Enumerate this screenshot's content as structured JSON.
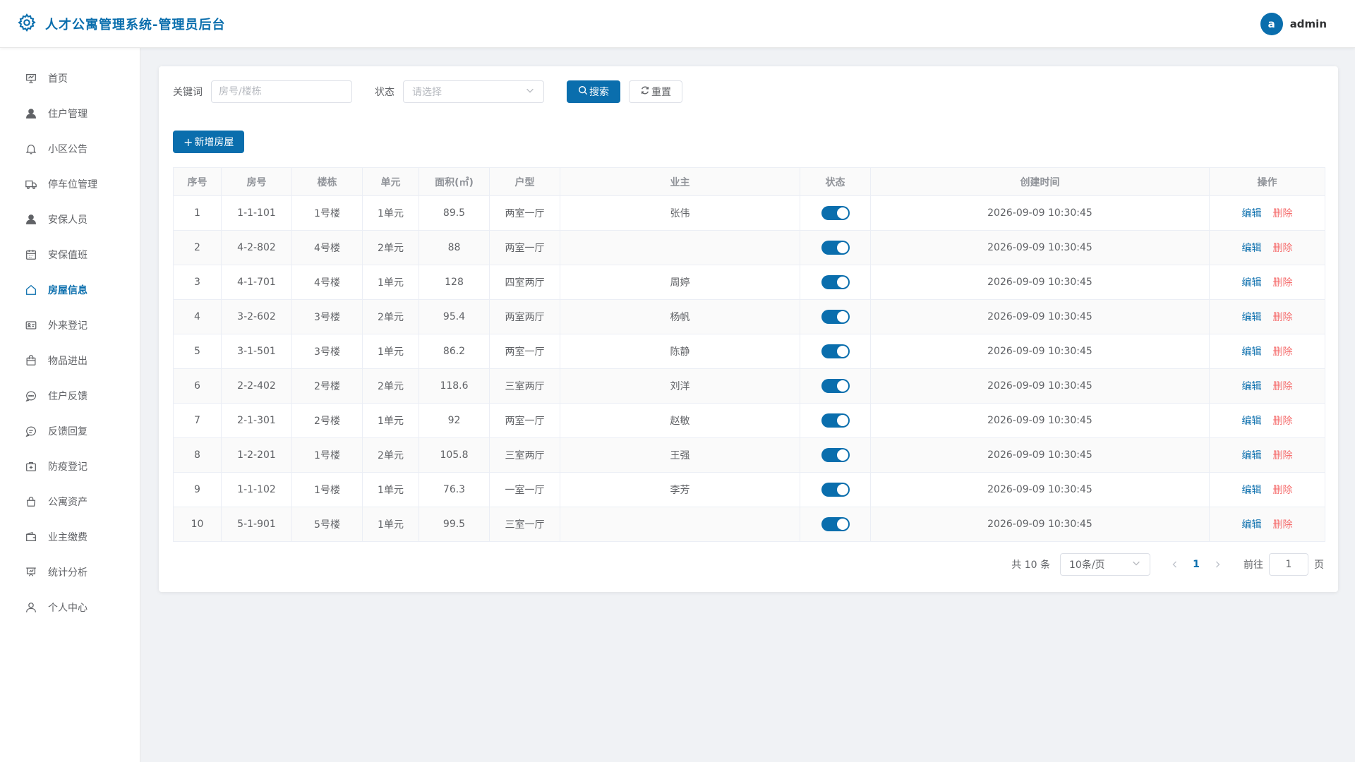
{
  "header": {
    "title": "人才公寓管理系统-管理员后台",
    "avatar_letter": "a",
    "username": "admin"
  },
  "sidebar": {
    "items": [
      {
        "label": "首页",
        "icon": "presentation-icon"
      },
      {
        "label": "住户管理",
        "icon": "user-solid-icon"
      },
      {
        "label": "小区公告",
        "icon": "bell-icon"
      },
      {
        "label": "停车位管理",
        "icon": "truck-icon"
      },
      {
        "label": "安保人员",
        "icon": "user-solid-icon"
      },
      {
        "label": "安保值班",
        "icon": "calendar-icon"
      },
      {
        "label": "房屋信息",
        "icon": "house-icon",
        "active": true
      },
      {
        "label": "外来登记",
        "icon": "id-card-icon"
      },
      {
        "label": "物品进出",
        "icon": "shopping-bag-icon"
      },
      {
        "label": "住户反馈",
        "icon": "chat-icon"
      },
      {
        "label": "反馈回复",
        "icon": "chat-lines-icon"
      },
      {
        "label": "防疫登记",
        "icon": "first-aid-kit-icon"
      },
      {
        "label": "公寓资产",
        "icon": "handbag-icon"
      },
      {
        "label": "业主缴费",
        "icon": "wallet-icon"
      },
      {
        "label": "统计分析",
        "icon": "data-board-icon"
      },
      {
        "label": "个人中心",
        "icon": "user-outline-icon"
      }
    ]
  },
  "filters": {
    "keyword_label": "关键词",
    "keyword_placeholder": "房号/楼栋",
    "status_label": "状态",
    "status_placeholder": "请选择",
    "search_label": "搜索",
    "reset_label": "重置"
  },
  "add_button": "新增房屋",
  "table": {
    "headers": [
      "序号",
      "房号",
      "楼栋",
      "单元",
      "面积(㎡)",
      "户型",
      "业主",
      "状态",
      "创建时间",
      "操作"
    ],
    "edit_label": "编辑",
    "delete_label": "删除",
    "rows": [
      {
        "no": "1",
        "room": "1-1-101",
        "building": "1号楼",
        "unit": "1单元",
        "area": "89.5",
        "layout": "两室一厅",
        "owner": "张伟",
        "status": true,
        "created": "2026-09-09 10:30:45"
      },
      {
        "no": "2",
        "room": "4-2-802",
        "building": "4号楼",
        "unit": "2单元",
        "area": "88",
        "layout": "两室一厅",
        "owner": "",
        "status": true,
        "created": "2026-09-09 10:30:45"
      },
      {
        "no": "3",
        "room": "4-1-701",
        "building": "4号楼",
        "unit": "1单元",
        "area": "128",
        "layout": "四室两厅",
        "owner": "周婷",
        "status": true,
        "created": "2026-09-09 10:30:45"
      },
      {
        "no": "4",
        "room": "3-2-602",
        "building": "3号楼",
        "unit": "2单元",
        "area": "95.4",
        "layout": "两室两厅",
        "owner": "杨帆",
        "status": true,
        "created": "2026-09-09 10:30:45"
      },
      {
        "no": "5",
        "room": "3-1-501",
        "building": "3号楼",
        "unit": "1单元",
        "area": "86.2",
        "layout": "两室一厅",
        "owner": "陈静",
        "status": true,
        "created": "2026-09-09 10:30:45"
      },
      {
        "no": "6",
        "room": "2-2-402",
        "building": "2号楼",
        "unit": "2单元",
        "area": "118.6",
        "layout": "三室两厅",
        "owner": "刘洋",
        "status": true,
        "created": "2026-09-09 10:30:45"
      },
      {
        "no": "7",
        "room": "2-1-301",
        "building": "2号楼",
        "unit": "1单元",
        "area": "92",
        "layout": "两室一厅",
        "owner": "赵敏",
        "status": true,
        "created": "2026-09-09 10:30:45"
      },
      {
        "no": "8",
        "room": "1-2-201",
        "building": "1号楼",
        "unit": "2单元",
        "area": "105.8",
        "layout": "三室两厅",
        "owner": "王强",
        "status": true,
        "created": "2026-09-09 10:30:45"
      },
      {
        "no": "9",
        "room": "1-1-102",
        "building": "1号楼",
        "unit": "1单元",
        "area": "76.3",
        "layout": "一室一厅",
        "owner": "李芳",
        "status": true,
        "created": "2026-09-09 10:30:45"
      },
      {
        "no": "10",
        "room": "5-1-901",
        "building": "5号楼",
        "unit": "1单元",
        "area": "99.5",
        "layout": "三室一厅",
        "owner": "",
        "status": true,
        "created": "2026-09-09 10:30:45"
      }
    ]
  },
  "pagination": {
    "total_text": "共 10 条",
    "page_size": "10条/页",
    "current_page": "1",
    "goto_label": "前往",
    "goto_value": "1",
    "page_unit": "页"
  },
  "colors": {
    "accent": "#0a6ead",
    "danger": "#f56c6c",
    "background": "#f0f2f5"
  }
}
